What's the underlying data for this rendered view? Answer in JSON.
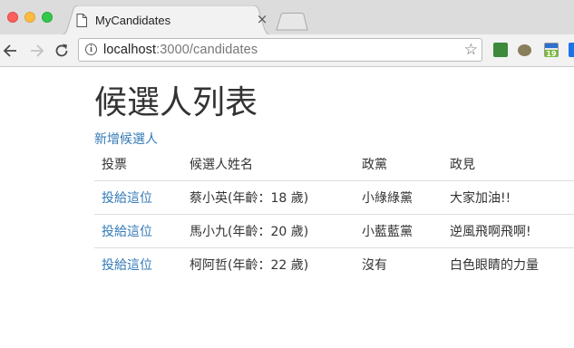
{
  "browser": {
    "tab": {
      "title": "MyCandidates",
      "close_glyph": "×",
      "icon": "document-icon"
    },
    "address": {
      "host": "localhost",
      "path": ":3000/candidates"
    },
    "extensions": [
      {
        "name": "evernote-icon",
        "color": "#3c8a3a"
      },
      {
        "name": "extension-icon",
        "color": "#8a7d5a"
      },
      {
        "name": "calendar-icon",
        "color": "#2e6fcf",
        "label": "19"
      },
      {
        "name": "extension-icon",
        "color": "#1a73e8"
      }
    ]
  },
  "page": {
    "title": "候選人列表",
    "new_link": "新增候選人",
    "table": {
      "headers": [
        "投票",
        "候選人姓名",
        "政黨",
        "政見"
      ],
      "rows": [
        {
          "vote": "投給這位",
          "name": "蔡小英(年齡：18 歲)",
          "party": "小綠綠黨",
          "policy": "大家加油!!"
        },
        {
          "vote": "投給這位",
          "name": "馬小九(年齡：20 歲)",
          "party": "小藍藍黨",
          "policy": "逆風飛啊飛啊!"
        },
        {
          "vote": "投給這位",
          "name": "柯阿哲(年齡：22 歲)",
          "party": "沒有",
          "policy": "白色眼睛的力量"
        }
      ]
    }
  },
  "colors": {
    "link": "#337ab7",
    "text": "#333333",
    "border": "#dddddd"
  }
}
